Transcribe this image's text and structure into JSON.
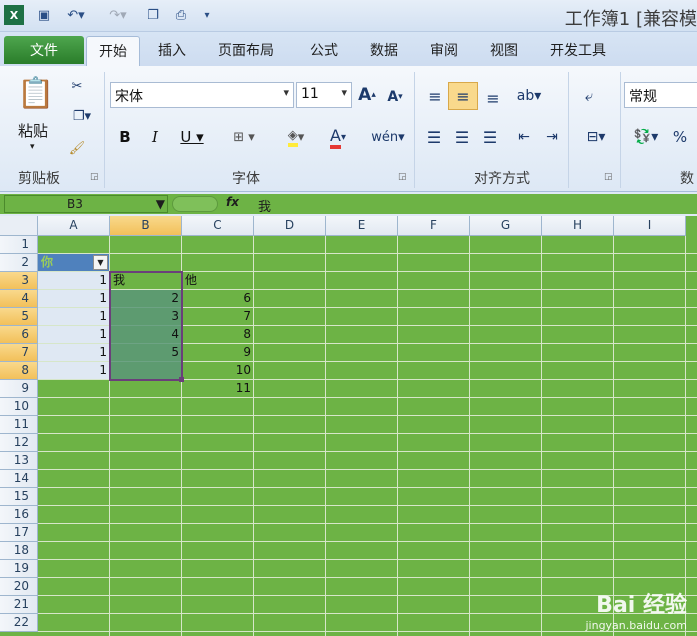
{
  "window": {
    "title": "工作簿1  [兼容模"
  },
  "tabs": [
    {
      "label": "文件"
    },
    {
      "label": "开始"
    },
    {
      "label": "插入"
    },
    {
      "label": "页面布局"
    },
    {
      "label": "公式"
    },
    {
      "label": "数据"
    },
    {
      "label": "审阅"
    },
    {
      "label": "视图"
    },
    {
      "label": "开发工具"
    }
  ],
  "ribbon": {
    "clipboard": {
      "label": "剪贴板",
      "paste_label": "粘贴"
    },
    "font": {
      "label": "字体",
      "font_name": "宋体",
      "font_size": "11"
    },
    "alignment": {
      "label": "对齐方式"
    },
    "number": {
      "label": "数",
      "format": "常规"
    }
  },
  "formula_bar": {
    "name_box": "B3",
    "fx": "fx",
    "content": "我"
  },
  "columns": [
    "A",
    "B",
    "C",
    "D",
    "E",
    "F",
    "G",
    "H",
    "I"
  ],
  "rows": [
    "1",
    "2",
    "3",
    "4",
    "5",
    "6",
    "7",
    "8",
    "9",
    "10",
    "11",
    "12",
    "13",
    "14",
    "15",
    "16",
    "17",
    "18",
    "19",
    "20",
    "21",
    "22"
  ],
  "cells": {
    "A2": "你",
    "A3": "1",
    "A4": "1",
    "A5": "1",
    "A6": "1",
    "A7": "1",
    "A8": "1",
    "B3": "我",
    "B4": "2",
    "B5": "3",
    "B6": "4",
    "B7": "5",
    "C3": "他",
    "C4": "6",
    "C5": "7",
    "C6": "8",
    "C7": "9",
    "C8": "10",
    "C9": "11"
  },
  "watermark": {
    "brand": "Bai 经验",
    "url": "jingyan.baidu.com"
  }
}
